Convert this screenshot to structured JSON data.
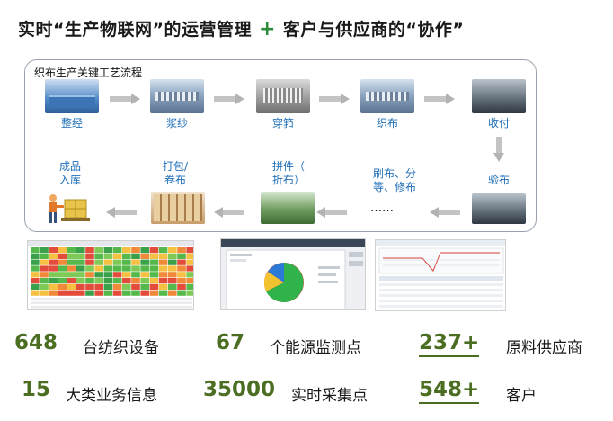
{
  "title": {
    "part1": "实时“生产物联网”的运营管理",
    "plus": "+",
    "part2": "客户与供应商的“协作”"
  },
  "process": {
    "heading": "织布生产关键工艺流程",
    "steps": {
      "warping": "整经",
      "sizing": "浆纱",
      "drawing_in": "穿筘",
      "weaving": "织布",
      "receiving": "收付",
      "inspection": "验布",
      "brushing_line1": "刷布、分",
      "brushing_line2": "等、修布",
      "ellipsis": "……",
      "piecing_line1": "拼件（",
      "piecing_line2": "折布）",
      "packing_line1": "打包/",
      "packing_line2": "卷布",
      "storage_line1": "成品",
      "storage_line2": "入库"
    }
  },
  "stats": [
    {
      "number": "648",
      "label": "台纺织设备"
    },
    {
      "number": "67",
      "label": "个能源监测点"
    },
    {
      "number": "237+",
      "label": "原料供应商"
    },
    {
      "number": "15",
      "label": "大类业务信息"
    },
    {
      "number": "35000",
      "label": "实时采集点"
    },
    {
      "number": "548+",
      "label": "客户"
    }
  ],
  "colors": {
    "accent_green": "#4b6e22",
    "step_blue": "#1f6fb8",
    "plus_green": "#2e8b3a"
  }
}
